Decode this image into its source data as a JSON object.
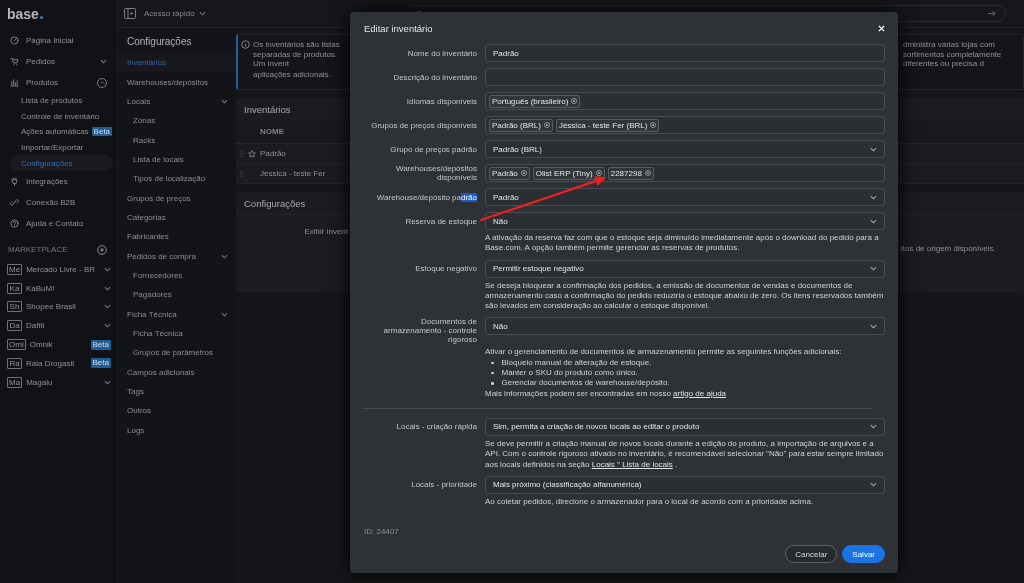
{
  "topbar": {
    "quick_access": "Acesso rápido"
  },
  "sidebar": {
    "logo": "base",
    "nav": [
      {
        "label": "Página Inicial"
      },
      {
        "label": "Pedidos",
        "expanded": false
      },
      {
        "label": "Produtos",
        "expanded": true,
        "children": [
          {
            "label": "Lista de produtos",
            "selected": false
          },
          {
            "label": "Controle de inventário",
            "selected": false
          },
          {
            "label": "Ações automáticas",
            "selected": false,
            "badge": "Beta"
          },
          {
            "label": "Importar/Exportar",
            "selected": false
          },
          {
            "label": "Configurações",
            "selected": true
          }
        ]
      },
      {
        "label": "Integrações"
      },
      {
        "label": "Conexão B2B"
      },
      {
        "label": "Ajuda e Contato"
      }
    ],
    "marketplace": {
      "title": "MARKETPLACE",
      "items": [
        {
          "code": "Me",
          "label": "Mercado Livre - BR",
          "expanded": false
        },
        {
          "code": "Ka",
          "label": "KaBuM!",
          "expanded": false
        },
        {
          "code": "Sh",
          "label": "Shopee Brasil",
          "expanded": false
        },
        {
          "code": "Da",
          "label": "Dafiti",
          "expanded": false
        },
        {
          "code": "Omi",
          "label": "Omnik",
          "badge": "Beta"
        },
        {
          "code": "Ra",
          "label": "Raia Drogasil",
          "badge": "Beta"
        },
        {
          "code": "Ma",
          "label": "Magalu",
          "expanded": false
        }
      ]
    }
  },
  "config_nav": {
    "title": "Configurações",
    "items": [
      {
        "label": "Inventários",
        "selected": true
      },
      {
        "label": "Warehouses/depósitos",
        "selected": false
      },
      {
        "label": "Locais",
        "selected": false,
        "expanded": true,
        "children": [
          {
            "label": "Zonas",
            "selected": false
          },
          {
            "label": "Racks",
            "selected": false
          },
          {
            "label": "Lista de locais",
            "selected": false
          },
          {
            "label": "Tipos de localização",
            "selected": false
          }
        ]
      },
      {
        "label": "Grupos de preços",
        "selected": false
      },
      {
        "label": "Categorias",
        "selected": false
      },
      {
        "label": "Fabricantes",
        "selected": false
      },
      {
        "label": "Pedidos de compra",
        "selected": false,
        "expanded": true,
        "children": [
          {
            "label": "Fornecedores",
            "selected": false
          },
          {
            "label": "Pagadores",
            "selected": false
          }
        ]
      },
      {
        "label": "Ficha Técnica",
        "selected": false,
        "expanded": true,
        "children": [
          {
            "label": "Ficha Técnica",
            "selected": false
          },
          {
            "label": "Grupos de parâmetros",
            "selected": false
          }
        ]
      },
      {
        "label": "Campos adicionais",
        "selected": false
      },
      {
        "label": "Tags",
        "selected": false
      },
      {
        "label": "Outros",
        "selected": false
      },
      {
        "label": "Logs",
        "selected": false
      }
    ]
  },
  "info": {
    "left_line_1": "Os inventários são listas separadas de produtos. Um invent",
    "right_line_1": "dministra várias lojas com sortimentos completamente diferentes ou precisa d",
    "left_line_2": "aplicações adicionais."
  },
  "inventories": {
    "title": "Inventários",
    "columns": [
      "NOME"
    ],
    "rows": [
      {
        "name": "Padrão",
        "default": true
      },
      {
        "name": "Jéssica - teste Fer",
        "default": false
      }
    ]
  },
  "settings_card": {
    "title": "Configurações",
    "left_text": "Exibir invent",
    "right_text": "itos de origem disponíveis."
  },
  "modal": {
    "title": "Editar inventário",
    "fields": [
      {
        "label": "Nome do inventário",
        "kind": "text",
        "value": "Padrão"
      },
      {
        "label": "Descrição do inventário",
        "kind": "text"
      },
      {
        "label": "Idiomas disponíveis",
        "kind": "tags",
        "tags": [
          "Português (brasileiro)"
        ]
      },
      {
        "label": "Grupos de preços disponíveis",
        "kind": "tags",
        "tags": [
          "Padrão (BRL)",
          "Jéssica - teste Fer (BRL)"
        ]
      },
      {
        "label": "Grupo de preços padrão",
        "kind": "select",
        "value": "Padrão (BRL)"
      },
      {
        "label": "Warehouses/depósitos disponíveis",
        "kind": "tags",
        "tags": [
          "Padrão",
          "Olist ERP (Tiny)",
          "2287298"
        ]
      },
      {
        "label": "Warehouse/depósito pa",
        "label_selected": "drão",
        "kind": "select",
        "value": "Padrão"
      },
      {
        "label": "Reserva de estoque",
        "kind": "select",
        "value": "Não",
        "description": [
          {
            "kind": "text",
            "parts": [
              {
                "text": "A ativação da reserva faz com que o estoque seja diminuído imediatamente após o download do pedido para a Base.com. A opção também permite gerenciar as reservas de produtos."
              }
            ]
          }
        ]
      },
      {
        "label": "Estoque negativo",
        "kind": "select",
        "value": "Permitir estoque negativo",
        "description": [
          {
            "kind": "text",
            "parts": [
              {
                "text": "Se deseja bloquear a confirmação dos pedidos, a emissão de documentos de vendas e documentos de armazenamento caso a confirmação do pedido reduziria o estoque abaixo de zero. Os itens reservados também são levados em consideração ao calcular o estoque disponível."
              }
            ]
          }
        ]
      },
      {
        "label": "Documentos de armazenamento - controle rigoroso",
        "kind": "select",
        "value": "Não",
        "description": [
          {
            "kind": "text",
            "parts": [
              {
                "text": "Ativar o gerenciamento de documentos de armazenamento permite as seguintes funções adicionais:"
              }
            ]
          },
          {
            "kind": "bullets",
            "items": [
              "Bloqueio manual de alteração de estoque.",
              "Manter o SKU do produto como único.",
              "Gerenciar documentos de warehouse/depósito."
            ]
          },
          {
            "kind": "text",
            "parts": [
              {
                "text": "Mais informações podem ser encontradas em nosso "
              },
              {
                "link": "artigo de ajuda"
              }
            ]
          }
        ]
      },
      {
        "label": "Locais - criação rápida",
        "kind": "select",
        "divider_before": true,
        "value": "Sim, permita a criação de novos locais ao editar o produto",
        "description": [
          {
            "kind": "text",
            "parts": [
              {
                "text": "Se deve permitir a criação manual de novos locais durante a edição do produto, a importação de arquivos e a API. Com o controle rigoroso ativado no inventário, é recomendável selecionar \"Não\" para estar sempre limitado aos locais definidos na seção "
              },
              {
                "link": "Locais \" Lista de locais"
              },
              {
                "text": " ."
              }
            ]
          }
        ]
      },
      {
        "label": "Locais - prioridade",
        "kind": "select",
        "value": "Mais próximo (classificação alfanumérica)",
        "description": [
          {
            "kind": "text",
            "parts": [
              {
                "text": "Ao coletar pedidos, direcione o armazenador para o local de acordo com a prioridade acima."
              }
            ]
          }
        ]
      }
    ],
    "id_text": "ID: 24407",
    "buttons": [
      {
        "label": "Cancelar",
        "kind": "secondary"
      },
      {
        "label": "Salvar",
        "kind": "primary"
      }
    ]
  },
  "annotations": [
    {
      "kind": "arrow"
    }
  ]
}
